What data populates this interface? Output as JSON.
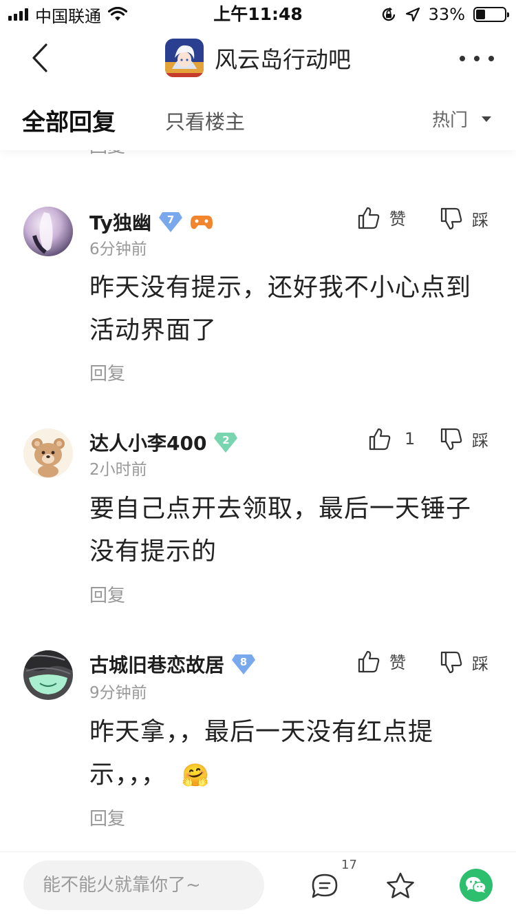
{
  "status_bar": {
    "carrier": "中国联通",
    "time": "上午11:48",
    "battery_percent_label": "33%",
    "battery_level": 0.33
  },
  "nav": {
    "title": "风云岛行动吧"
  },
  "tabs": {
    "all_replies": "全部回复",
    "owner_only": "只看楼主",
    "sort": "热门"
  },
  "cut_reply": "回复",
  "comments": [
    {
      "username": "Ty独幽",
      "level": "7",
      "time": "6分钟前",
      "text": "昨天没有提示，还好我不小心点到活动界面了",
      "like_label": "赞",
      "dislike_label": "踩",
      "reply_label": "回复"
    },
    {
      "username": "达人小李400",
      "level": "2",
      "time": "2小时前",
      "text": "要自己点开去领取，最后一天锤子没有提示的",
      "like_label": "1",
      "dislike_label": "踩",
      "reply_label": "回复"
    },
    {
      "username": "古城旧巷恋故居",
      "level": "8",
      "time": "9分钟前",
      "text": "昨天拿，，最后一天没有红点提示，，，",
      "emoji": "🤗",
      "like_label": "赞",
      "dislike_label": "踩",
      "reply_label": "回复"
    }
  ],
  "bottom_bar": {
    "input_placeholder": "能不能火就靠你了~",
    "comment_count": "17"
  },
  "colors": {
    "badge_blue": "#7aa8ec",
    "badge_green": "#79d4b0",
    "wechat_green": "#2dbf6e"
  }
}
